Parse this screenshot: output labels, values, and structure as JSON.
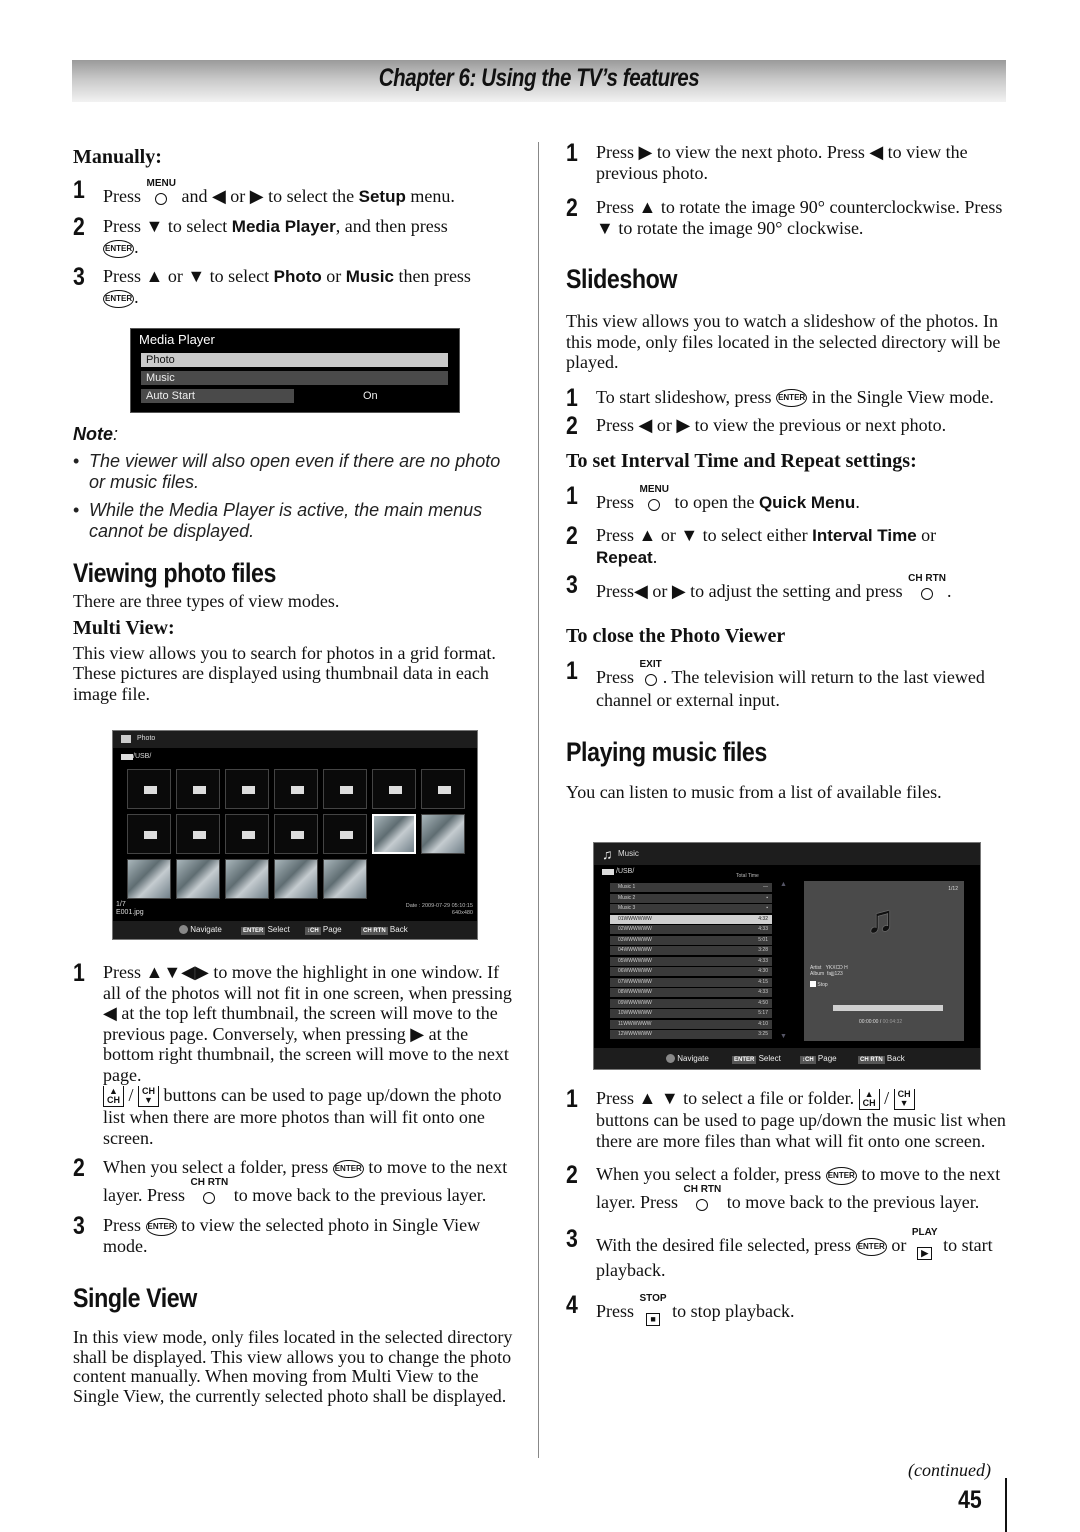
{
  "header": {
    "chapter_title": "Chapter 6: Using the TV’s features"
  },
  "left": {
    "manually_heading": "Manually:",
    "manual_steps": [
      {
        "num": "1",
        "parts": [
          "Press",
          "MENU",
          "and ◀ or ▶ to select the",
          "Setup",
          "menu."
        ]
      },
      {
        "num": "2",
        "parts": [
          "Press ▼ to select",
          "Media Player",
          ", and then press",
          "ENTER",
          "."
        ]
      },
      {
        "num": "3",
        "parts": [
          "Press ▲ or ▼ to select",
          "Photo",
          "or",
          "Music",
          "then press",
          "ENTER",
          "."
        ]
      }
    ],
    "media_player_menu": {
      "title": "Media Player",
      "items": [
        {
          "label": "Photo",
          "value": ""
        },
        {
          "label": "Music",
          "value": ""
        },
        {
          "label": "Auto Start",
          "value": "On"
        }
      ]
    },
    "note_title": "Note",
    "notes": [
      "The viewer will also open even if there are no photo or music files.",
      "While the Media Player is active, the main menus cannot be displayed."
    ],
    "viewing_heading": "Viewing photo files",
    "viewing_intro": "There are three types of view modes.",
    "multi_heading": "Multi View:",
    "multi_text": "This view allows you to search for photos in a grid format. These pictures are displayed using thumbnail data in each image file.",
    "photo_screen": {
      "title": "Photo",
      "path": "/USB/",
      "counter": "1/7",
      "filename": "E001.jpg",
      "date": "Date : 2009-07-29 05:10:15",
      "resolution": "640x480",
      "footer": [
        {
          "key": "navigate",
          "tag": "",
          "label": "Navigate"
        },
        {
          "key": "enter",
          "tag": "ENTER",
          "label": "Select"
        },
        {
          "key": "ch",
          "tag": "↕CH",
          "label": "Page"
        },
        {
          "key": "chrtn",
          "tag": "CH RTN",
          "label": "Back"
        }
      ]
    },
    "multi_steps": [
      "Press ▲▼◀▶ to move the highlight in one window. If all of the photos will not fit in one screen, when pressing ◀ at the top left thumbnail, the screen will move to the previous page. Conversely, when pressing ▶ at the bottom right thumbnail, the screen will move to the next page.",
      "buttons can be used to page up/down the photo list when there are more photos than will fit onto one screen.",
      "When you select a folder, press",
      "to move to the next layer. Press",
      "to move back to the previous layer.",
      "Press",
      "to view the selected photo in Single View mode."
    ],
    "single_heading": "Single View",
    "single_text": "In this view mode, only files located in the selected directory shall be displayed. This view allows you to change the photo content manually. When moving from Multi View to the Single View, the currently selected photo shall be displayed."
  },
  "right": {
    "single_steps": [
      "Press ▶ to view the next photo. Press ◀ to view the previous photo.",
      "Press ▲ to rotate the image 90° counterclockwise. Press ▼ to rotate the image 90° clockwise."
    ],
    "slideshow_heading": "Slideshow",
    "slideshow_text": "This view allows you to watch a slideshow of the photos. In this mode, only files located in the selected directory will be played.",
    "slideshow_steps": [
      "To start slideshow, press",
      "in the Single View mode.",
      "Press ◀ or ▶ to view the previous or next photo."
    ],
    "interval_heading": "To set Interval Time and Repeat settings:",
    "interval_steps": {
      "s1a": "Press",
      "s1b": "to open the",
      "s1c": "Quick Menu",
      "s1d": ".",
      "s2a": "Press ▲ or ▼ to select either",
      "s2b": "Interval Time",
      "s2c": "or",
      "s2d": "Repeat",
      "s2e": ".",
      "s3a": "Press◀ or ▶ to adjust the setting and press",
      "s3b": "."
    },
    "close_heading": "To close the Photo Viewer",
    "close_steps": {
      "a": "Press",
      "b": ". The television will return to the last viewed channel or external input."
    },
    "music_heading": "Playing music files",
    "music_intro": "You can listen to music from a list of available files.",
    "music_screen": {
      "title": "Music",
      "path": "/USB/",
      "total_time_label": "Total Time",
      "rows": [
        {
          "name": "Music 1",
          "time": "—"
        },
        {
          "name": "Music 2",
          "time": "▪"
        },
        {
          "name": "Music 3",
          "time": "▪"
        },
        {
          "name": "01WWWWWW",
          "time": "4:32"
        },
        {
          "name": "02WWWWWW",
          "time": "4:33"
        },
        {
          "name": "03WWWWWW",
          "time": "5:01"
        },
        {
          "name": "04WWWWWW",
          "time": "3:28"
        },
        {
          "name": "05WWWWWW",
          "time": "4:33"
        },
        {
          "name": "06WWWWWW",
          "time": "4:30"
        },
        {
          "name": "07WWWWWW",
          "time": "4:15"
        },
        {
          "name": "08WWWWWW",
          "time": "4:33"
        },
        {
          "name": "09WWWWWW",
          "time": "4:50"
        },
        {
          "name": "10WWWWWW",
          "time": "5:17"
        },
        {
          "name": "11WWWWWW",
          "time": "4:10"
        },
        {
          "name": "12WWWWWW",
          "time": "3:25"
        }
      ],
      "selected_index": 3,
      "counter": "1/12",
      "artist_label": "Artist",
      "artist": "YKXCD H",
      "album_label": "Album",
      "album": "fajjj123",
      "state": "Stop",
      "elapsed": "00:00:00",
      "total": "00:04:32",
      "progress": 0,
      "footer": [
        {
          "tag": "",
          "label": "Navigate"
        },
        {
          "tag": "ENTER",
          "label": "Select"
        },
        {
          "tag": "↕CH",
          "label": "Page"
        },
        {
          "tag": "CH RTN",
          "label": "Back"
        }
      ]
    },
    "music_steps": {
      "s1a": "Press ▲ ▼ to select a file or folder.",
      "s1b": "buttons can be used to page up/down the music list when there are more files than what will fit onto one screen.",
      "s2a": "When you select a folder, press",
      "s2b": "to move to the next layer. Press",
      "s2c": "to move back to the previous layer.",
      "s3a": "With the desired file selected, press",
      "s3b": "or",
      "s3c": "to start playback.",
      "s4a": "Press",
      "s4b": "to stop playback."
    },
    "continued": "(continued)",
    "page_number": "45"
  },
  "buttons": {
    "menu": "MENU",
    "enter": "ENTER",
    "chrtn": "CH RTN",
    "exit": "EXIT",
    "play": "PLAY",
    "stop": "STOP",
    "ch": "CH"
  }
}
